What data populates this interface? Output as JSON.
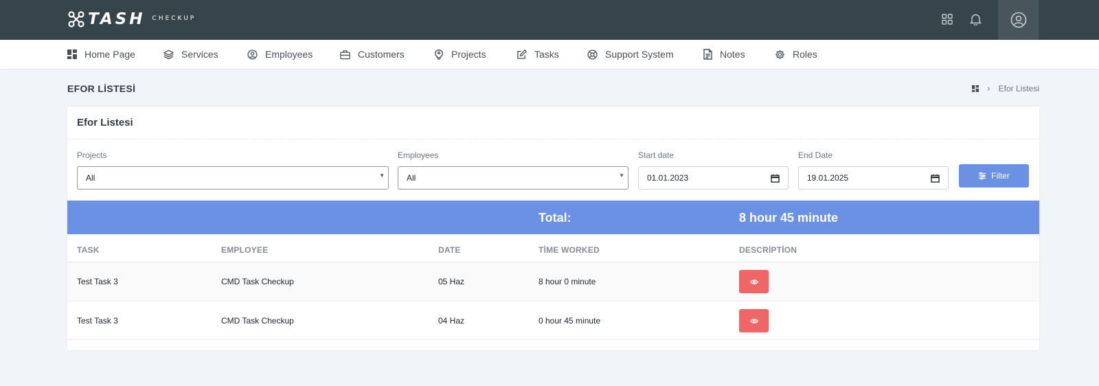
{
  "brand": {
    "name": "TASH",
    "sub": "CHECKUP"
  },
  "nav": [
    {
      "label": "Home Page",
      "icon": "dashboard-icon"
    },
    {
      "label": "Services",
      "icon": "layers-icon"
    },
    {
      "label": "Employees",
      "icon": "user-circle-icon"
    },
    {
      "label": "Customers",
      "icon": "briefcase-icon"
    },
    {
      "label": "Projects",
      "icon": "lightbulb-icon"
    },
    {
      "label": "Tasks",
      "icon": "edit-icon"
    },
    {
      "label": "Support System",
      "icon": "support-icon"
    },
    {
      "label": "Notes",
      "icon": "file-text-icon"
    },
    {
      "label": "Roles",
      "icon": "gear-icon"
    }
  ],
  "page": {
    "title": "EFOR LİSTESİ",
    "breadcrumb": "Efor Listesi"
  },
  "card": {
    "title": "Efor Listesi"
  },
  "filters": {
    "projects": {
      "label": "Projects",
      "value": "All"
    },
    "employees": {
      "label": "Employees",
      "value": "All"
    },
    "start": {
      "label": "Start date",
      "value": "01.01.2023"
    },
    "end": {
      "label": "End Date",
      "value": "19.01.2025"
    },
    "button": "Filter"
  },
  "total": {
    "label": "Total:",
    "value": "8 hour 45 minute"
  },
  "table": {
    "headers": [
      "TASK",
      "EMPLOYEE",
      "DATE",
      "TİME WORKED",
      "DESCRİPTİON"
    ],
    "rows": [
      {
        "task": "Test Task 3",
        "employee": "CMD Task Checkup",
        "date": "05 Haz",
        "time": "8 hour 0 minute"
      },
      {
        "task": "Test Task 3",
        "employee": "CMD Task Checkup",
        "date": "04 Haz",
        "time": "0 hour 45 minute"
      }
    ]
  },
  "colors": {
    "topbar": "#36444c",
    "primary": "#6b91e5",
    "danger": "#f06565"
  }
}
